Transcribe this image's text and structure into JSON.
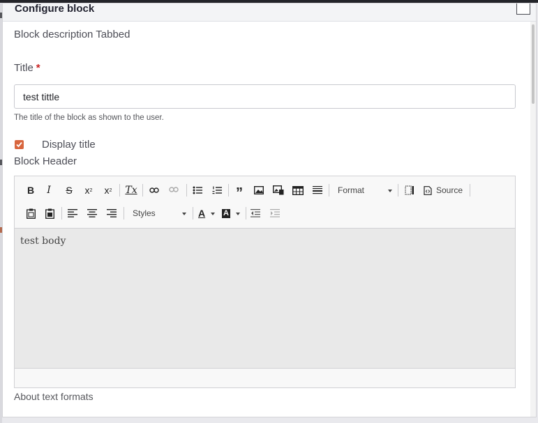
{
  "dialog": {
    "title": "Configure block",
    "block_description": "Block description Tabbed",
    "title_label": "Title",
    "required_mark": "*",
    "title_value": "test tittle",
    "title_hint": "The title of the block as shown to the user.",
    "display_title_label": "Display title",
    "display_title_checked": true,
    "block_header_label": "Block Header",
    "about_formats": "About text formats"
  },
  "editor": {
    "toolbar_row1": {
      "bold": "B",
      "italic": "I",
      "strike": "S",
      "superscript": "x",
      "subscript": "x",
      "remove_format": "Tx",
      "format_label": "Format",
      "source_label": "Source"
    },
    "toolbar_row2": {
      "styles_label": "Styles",
      "text_color": "A",
      "bg_color": "A"
    },
    "content": "test body"
  },
  "colors": {
    "accent": "#d8663e",
    "required": "#c81e1e"
  }
}
